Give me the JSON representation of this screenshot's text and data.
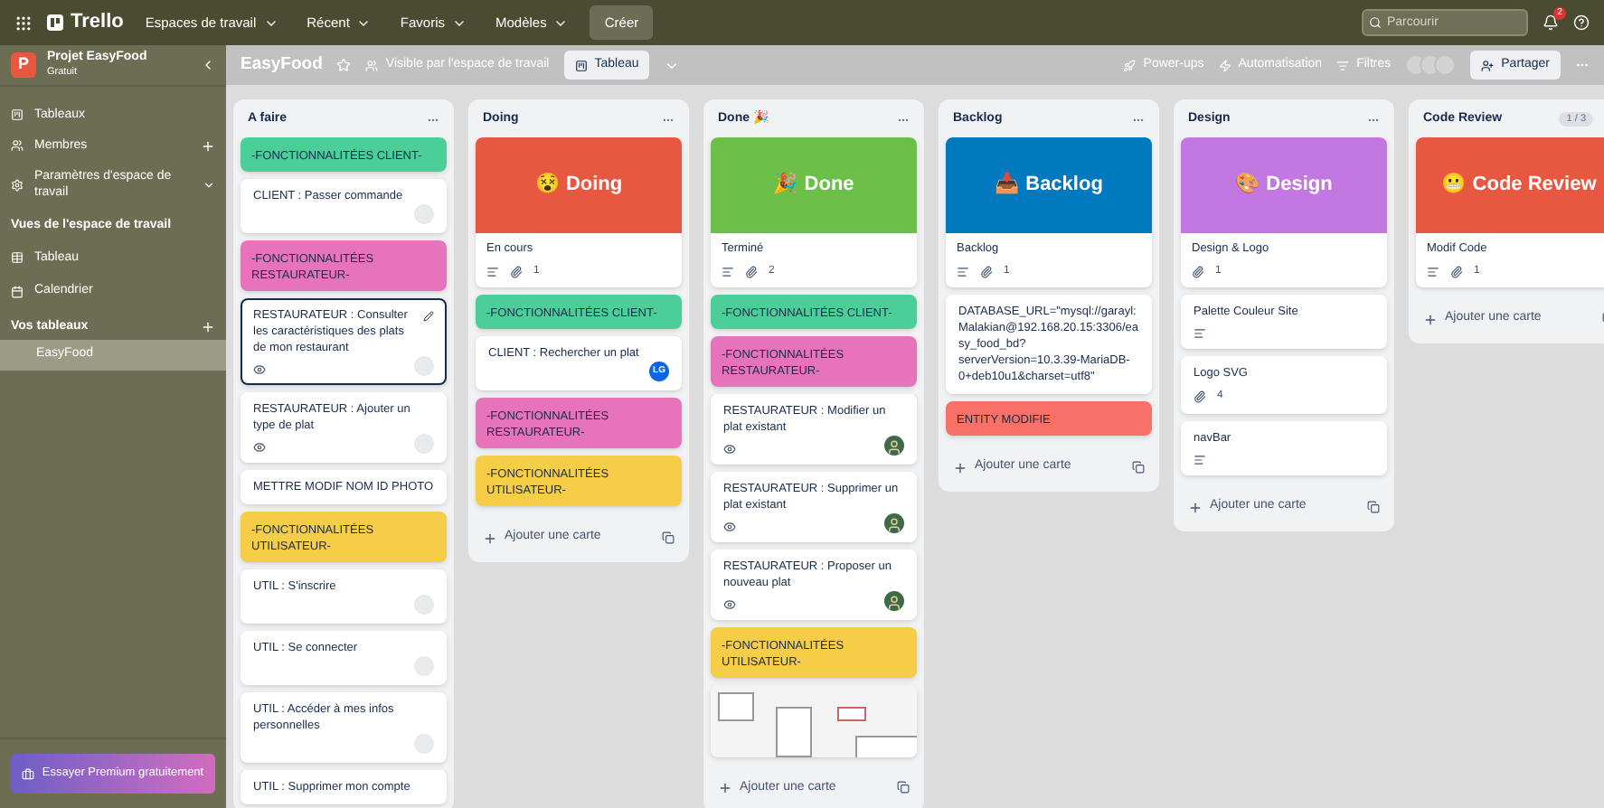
{
  "topbar": {
    "logo": "Trello",
    "menus": [
      "Espaces de travail",
      "Récent",
      "Favoris",
      "Modèles"
    ],
    "create": "Créer",
    "search": {
      "placeholder": "Parcourir"
    },
    "notification_count": "2"
  },
  "sidebar": {
    "workspace": {
      "letter": "P",
      "name": "Projet EasyFood",
      "plan": "Gratuit"
    },
    "items": [
      {
        "label": "Tableaux",
        "kind": "plain"
      },
      {
        "label": "Membres",
        "kind": "plus"
      },
      {
        "label": "Paramètres d'espace de travail",
        "kind": "chevron"
      }
    ],
    "views_title": "Vues de l'espace de travail",
    "views": [
      {
        "label": "Tableau"
      },
      {
        "label": "Calendrier"
      }
    ],
    "boards_title": "Vos tableaux",
    "boards": [
      {
        "label": "EasyFood",
        "selected": true
      }
    ],
    "premium": "Essayer Premium gratuitement"
  },
  "board_header": {
    "title": "EasyFood",
    "visibility": "Visible par l'espace de travail",
    "view": "Tableau",
    "powerups": "Power-ups",
    "automation": "Automatisation",
    "filters": "Filtres",
    "share": "Partager"
  },
  "lists": [
    {
      "title": "A faire",
      "cards": [
        {
          "kind": "label",
          "text": "-FONCTIONNALITÉES CLIENT-",
          "color": "#4bce97"
        },
        {
          "kind": "task",
          "text": "CLIENT : Passer commande",
          "description": false,
          "watching": false,
          "member": {
            "kind": "blank"
          },
          "selected": false
        },
        {
          "kind": "label",
          "text": "-FONCTIONNALITÉES RESTAURATEUR-",
          "color": "#e774bb"
        },
        {
          "kind": "task",
          "text": "RESTAURATEUR : Consulter les caractéristiques des plats de mon restaurant",
          "description": false,
          "watching": true,
          "member": {
            "kind": "blank"
          },
          "selected": true
        },
        {
          "kind": "task",
          "text": "RESTAURATEUR : Ajouter un type de plat",
          "description": false,
          "watching": true,
          "member": {
            "kind": "blank"
          },
          "selected": false
        },
        {
          "kind": "task",
          "text": "METTRE MODIF NOM ID PHOTO",
          "description": false,
          "watching": false,
          "selected": false
        },
        {
          "kind": "label",
          "text": "-FONCTIONNALITÉES UTILISATEUR-",
          "color": "#f5cd47"
        },
        {
          "kind": "task",
          "text": "UTIL : S'inscrire",
          "description": false,
          "watching": false,
          "member": {
            "kind": "blank"
          },
          "selected": false
        },
        {
          "kind": "task",
          "text": "UTIL : Se connecter",
          "description": false,
          "watching": false,
          "member": {
            "kind": "blank"
          },
          "selected": false
        },
        {
          "kind": "task",
          "text": "UTIL : Accéder à mes infos personnelles",
          "description": false,
          "watching": false,
          "member": {
            "kind": "blank"
          },
          "selected": false
        },
        {
          "kind": "task",
          "text": "UTIL : Supprimer mon compte",
          "description": false,
          "watching": false,
          "selected": false
        }
      ]
    },
    {
      "title": "Doing",
      "add_card": "Ajouter une carte",
      "cards": [
        {
          "kind": "cover",
          "cover_title": "😵 Doing",
          "color": "#e8573f",
          "text": "En cours",
          "description": true,
          "attachments": "1"
        },
        {
          "kind": "label",
          "text": "-FONCTIONNALITÉES CLIENT-",
          "color": "#4bce97"
        },
        {
          "kind": "task",
          "text": "CLIENT : Rechercher un plat",
          "description": false,
          "watching": false,
          "member": {
            "kind": "initials",
            "initials": "LG"
          },
          "selected": false
        },
        {
          "kind": "label",
          "text": "-FONCTIONNALITÉES RESTAURATEUR-",
          "color": "#e774bb"
        },
        {
          "kind": "label",
          "text": "-FONCTIONNALITÉES UTILISATEUR-",
          "color": "#f5cd47"
        }
      ]
    },
    {
      "title": "Done 🎉",
      "add_card": "Ajouter une carte",
      "cards": [
        {
          "kind": "cover",
          "cover_title": "🎉 Done",
          "color": "#6cc04a",
          "text": "Terminé",
          "description": true,
          "attachments": "2"
        },
        {
          "kind": "label",
          "text": "-FONCTIONNALITÉES CLIENT-",
          "color": "#4bce97"
        },
        {
          "kind": "label",
          "text": "-FONCTIONNALITÉES RESTAURATEUR-",
          "color": "#e774bb"
        },
        {
          "kind": "task",
          "text": "RESTAURATEUR : Modifier un plat existant",
          "description": false,
          "watching": true,
          "member": {
            "kind": "photo"
          },
          "selected": false
        },
        {
          "kind": "task",
          "text": "RESTAURATEUR : Supprimer un plat existant",
          "description": false,
          "watching": true,
          "member": {
            "kind": "photo"
          },
          "selected": false
        },
        {
          "kind": "task",
          "text": "RESTAURATEUR : Proposer un nouveau plat",
          "description": false,
          "watching": true,
          "member": {
            "kind": "photo"
          },
          "selected": false
        },
        {
          "kind": "label",
          "text": "-FONCTIONNALITÉES UTILISATEUR-",
          "color": "#f5cd47"
        },
        {
          "kind": "image"
        }
      ]
    },
    {
      "title": "Backlog",
      "add_card": "Ajouter une carte",
      "cards": [
        {
          "kind": "cover",
          "cover_title": "📥 Backlog",
          "color": "#0079bf",
          "text": "Backlog",
          "description": true,
          "attachments": "1"
        },
        {
          "kind": "task",
          "text": "DATABASE_URL=\"mysql://garayl:Malakian@192.168.20.15:3306/easy_food_bd?serverVersion=10.3.39-MariaDB-0+deb10u1&charset=utf8\"",
          "description": false,
          "watching": false,
          "selected": false
        },
        {
          "kind": "label",
          "text": "ENTITY MODIFIE",
          "color": "#f87168"
        }
      ]
    },
    {
      "title": "Design",
      "add_card": "Ajouter une carte",
      "cards": [
        {
          "kind": "cover",
          "cover_title": "🎨 Design",
          "color": "#c377e0",
          "text": "Design & Logo",
          "description": false,
          "attachments": "1"
        },
        {
          "kind": "task",
          "text": "Palette Couleur Site",
          "description": true,
          "watching": false,
          "selected": false
        },
        {
          "kind": "task",
          "text": "Logo SVG",
          "description": false,
          "attachments": "4",
          "watching": false,
          "selected": false
        },
        {
          "kind": "task",
          "text": "navBar",
          "description": true,
          "watching": false,
          "selected": false
        }
      ]
    },
    {
      "title": "Code Review",
      "count": "1 / 3",
      "add_card": "Ajouter une carte",
      "cards": [
        {
          "kind": "cover",
          "cover_title": "😬 Code Review",
          "color": "#e8573f",
          "text": "Modif Code",
          "description": true,
          "attachments": "1"
        }
      ]
    }
  ]
}
